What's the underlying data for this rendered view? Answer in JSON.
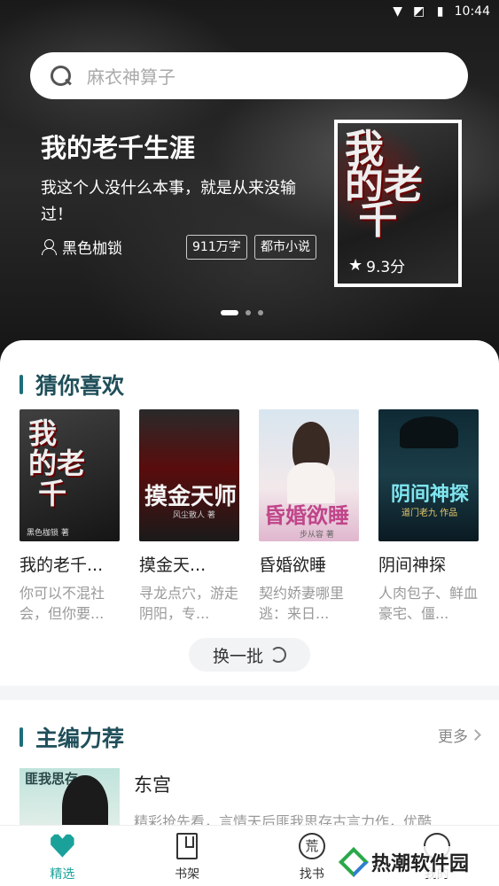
{
  "status_bar": {
    "time": "10:44"
  },
  "search": {
    "placeholder": "麻衣神算子"
  },
  "banner": {
    "title": "我的老千生涯",
    "description": "我这个人没什么本事，就是从来没输过！",
    "author": "黑色枷锁",
    "tags": [
      "911万字",
      "都市小说"
    ],
    "rating": "9.3分",
    "cover_text": "我的老千生涯",
    "page_index": 0,
    "page_count": 3
  },
  "guess": {
    "title": "猜你喜欢",
    "books": [
      {
        "title": "我的老千...",
        "desc": "你可以不混社会，但你要...",
        "cover_text": "我的老千",
        "cover_author": "黑色枷锁 著"
      },
      {
        "title": "摸金天...",
        "desc": "寻龙点穴，游走阴阳，专...",
        "cover_text": "摸金天师",
        "cover_author": "风尘散人 著"
      },
      {
        "title": "昏婚欲睡",
        "desc": "契约娇妻哪里逃：来日...",
        "cover_text": "昏婚欲睡",
        "cover_author": "步从容 著"
      },
      {
        "title": "阴间神探",
        "desc": "人肉包子、鲜血豪宅、僵...",
        "cover_text": "阴间神探",
        "cover_author": "道门老九 作品"
      }
    ],
    "swap_label": "换一批"
  },
  "editor_picks": {
    "title": "主编力荐",
    "more_label": "更多",
    "book": {
      "title": "东宫",
      "desc": "精彩抢先看，言情天后匪我思存古言力作，优酷",
      "cover_text": "匪我思存"
    }
  },
  "nav": [
    {
      "label": "精选",
      "icon": "heart-icon",
      "active": true
    },
    {
      "label": "书架",
      "icon": "bookshelf-icon",
      "active": false
    },
    {
      "label": "找书",
      "icon": "find-book-icon",
      "active": false
    },
    {
      "label": "我的",
      "icon": "profile-icon",
      "active": false
    }
  ],
  "watermark": {
    "text": "热潮软件园"
  },
  "colors": {
    "accent": "#1aa29a",
    "section_title": "#1f4f5a"
  }
}
